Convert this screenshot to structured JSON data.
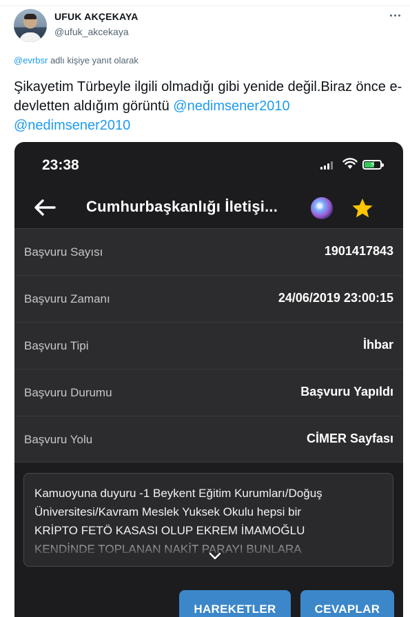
{
  "tweet": {
    "display_name": "UFUK AKÇEKAYA",
    "handle": "@ufuk_akcekaya",
    "reply_to_handle": "@evrbsr",
    "reply_suffix": " adlı kişiye yanıt olarak",
    "text": "Şikayetim Türbeyle ilgili olmadığı gibi yenide değil.Biraz önce e-devletten aldığım görüntü ",
    "mention_1": "@nedimsener2010",
    "mention_2": "@nedimsener2010",
    "link_color": "#1d9bf0"
  },
  "screenshot": {
    "status_time": "23:38",
    "nav_title": "Cumhurbaşkanlığı İletişi...",
    "rows": [
      {
        "label": "Başvuru Sayısı",
        "value": "1901417843"
      },
      {
        "label": "Başvuru Zamanı",
        "value": "24/06/2019 23:00:15"
      },
      {
        "label": "Başvuru Tipi",
        "value": "İhbar"
      },
      {
        "label": "Başvuru Durumu",
        "value": "Başvuru Yapıldı"
      },
      {
        "label": "Başvuru Yolu",
        "value": "CİMER Sayfası"
      }
    ],
    "description": "Kamuoyuna duyuru -1 Beykent Eğitim Kurumları/Doğuş\nÜniversitesi/Kavram Meslek Yuksek Okulu hepsi bir\nKRİPTO FETÖ KASASI OLUP EKREM İMAMOĞLU\nKENDİNDE TOPLANAN NAKİT PARAYI BUNLARA",
    "buttons": {
      "movements": "HAREKETLER",
      "replies": "CEVAPLAR"
    },
    "icons": [
      "back-arrow-icon",
      "siri-icon",
      "star-icon",
      "signal-icon",
      "wifi-icon",
      "battery-icon",
      "chevron-down-icon"
    ],
    "accent_button_color": "#3c87c9",
    "star_color": "#ffc500",
    "battery_color": "#34c759"
  }
}
